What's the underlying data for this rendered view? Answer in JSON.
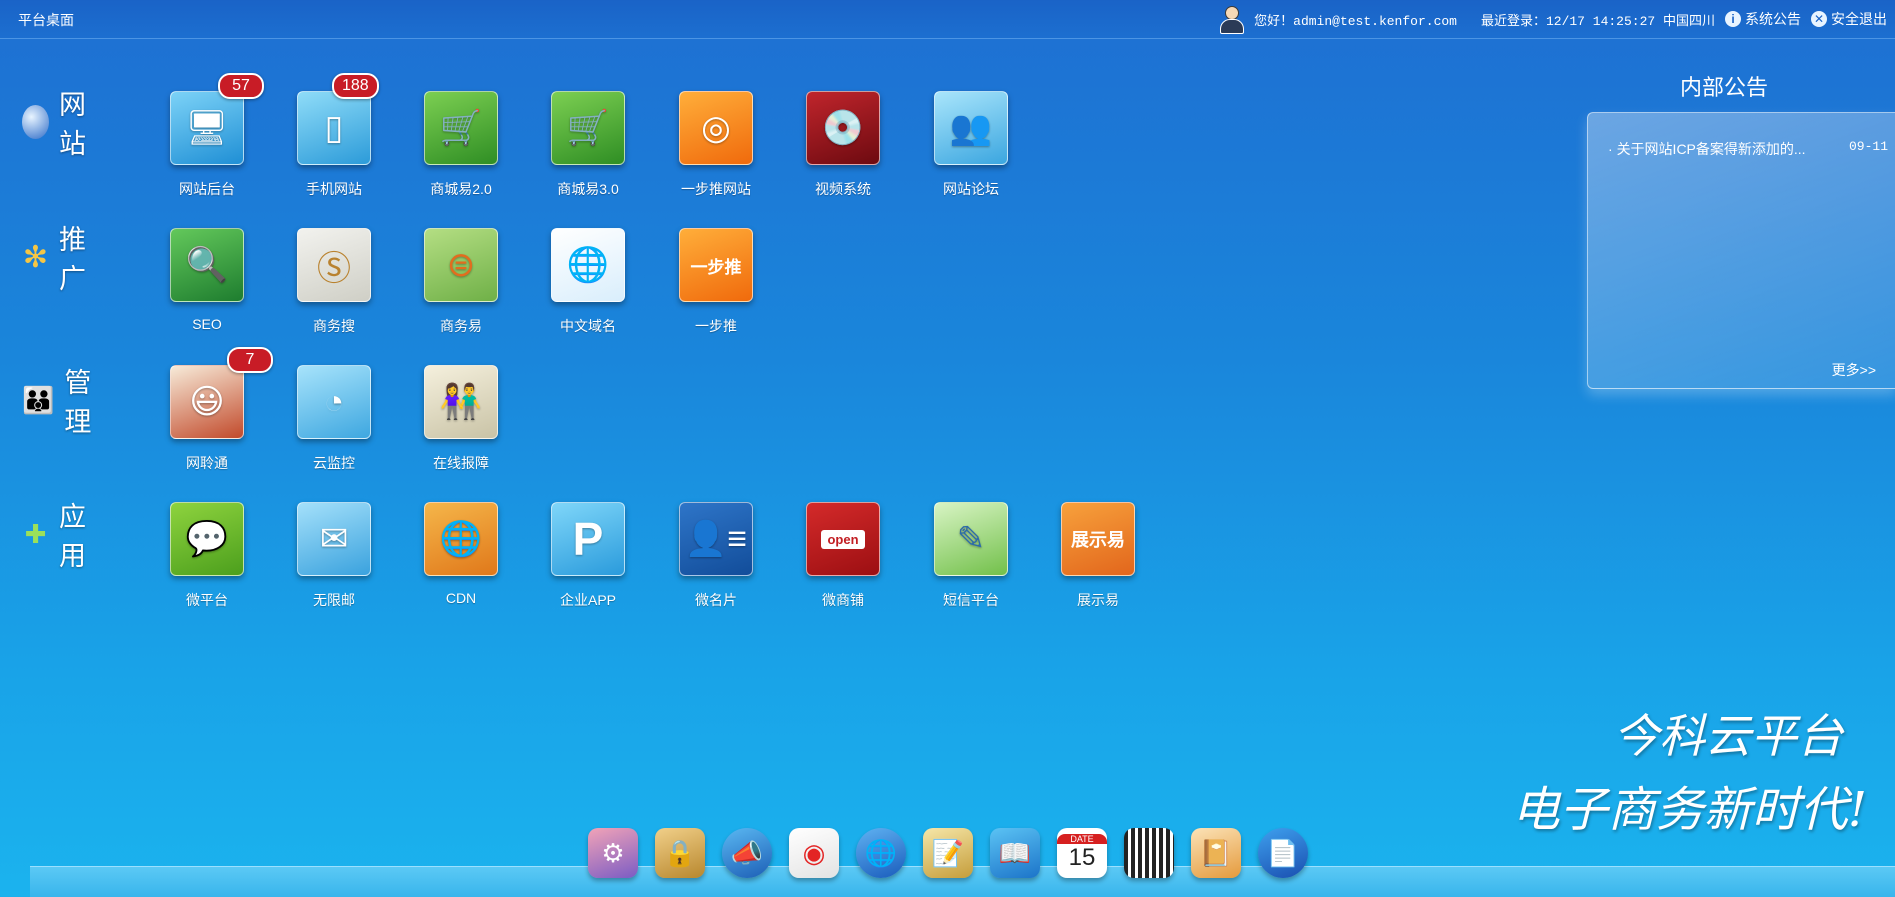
{
  "topbar": {
    "title": "平台桌面",
    "greeting": "您好！admin@test.kenfor.com",
    "last_login": "最近登录：12/17 14:25:27 中国四川",
    "notice_link": "系统公告",
    "logout_link": "安全退出"
  },
  "categories": [
    {
      "label": "网 站",
      "icon": "globe-icon"
    },
    {
      "label": "推 广",
      "icon": "star-icon"
    },
    {
      "label": "管 理",
      "icon": "people-icon"
    },
    {
      "label": "应 用",
      "icon": "apps-icon"
    }
  ],
  "apps": {
    "website": [
      {
        "label": "网站后台",
        "icon": "monitor-globe-icon",
        "badge": "57"
      },
      {
        "label": "手机网站",
        "icon": "tablet-icon",
        "badge": "188"
      },
      {
        "label": "商城易2.0",
        "icon": "cart-icon"
      },
      {
        "label": "商城易3.0",
        "icon": "cart-icon"
      },
      {
        "label": "一步推网站",
        "icon": "compass-icon"
      },
      {
        "label": "视频系统",
        "icon": "dvd-icon"
      },
      {
        "label": "网站论坛",
        "icon": "forum-people-icon"
      }
    ],
    "promotion": [
      {
        "label": "SEO",
        "icon": "magnifier-icon"
      },
      {
        "label": "商务搜",
        "icon": "s-logo-icon"
      },
      {
        "label": "商务易",
        "icon": "coin-logo-icon"
      },
      {
        "label": "中文域名",
        "icon": "domain-globe-icon"
      },
      {
        "label": "一步推",
        "icon": "yibutui-icon",
        "glyph_text": "一步推"
      }
    ],
    "manage": [
      {
        "label": "网聆通",
        "icon": "smiley-icon",
        "badge": "7"
      },
      {
        "label": "云监控",
        "icon": "pie-chart-icon"
      },
      {
        "label": "在线报障",
        "icon": "support-people-icon"
      }
    ],
    "apps": [
      {
        "label": "微平台",
        "icon": "phone-chat-icon"
      },
      {
        "label": "无限邮",
        "icon": "envelope-icon"
      },
      {
        "label": "CDN",
        "icon": "globe-orb-icon"
      },
      {
        "label": "企业APP",
        "icon": "p-logo-icon"
      },
      {
        "label": "微名片",
        "icon": "business-card-icon"
      },
      {
        "label": "微商铺",
        "icon": "shop-open-icon",
        "glyph_text": "open"
      },
      {
        "label": "短信平台",
        "icon": "sms-pen-icon"
      },
      {
        "label": "展示易",
        "icon": "zhanshiyi-icon",
        "glyph_text": "展示易"
      }
    ]
  },
  "notice": {
    "title": "内部公告",
    "items": [
      {
        "text": "关于网站ICP备案得新添加的...",
        "date": "09-11"
      }
    ],
    "more": "更多>>"
  },
  "slogan": {
    "line1": "今科云平台",
    "line2": "电子商务新时代!"
  },
  "dock": [
    {
      "icon": "user-settings-icon"
    },
    {
      "icon": "lock-icon"
    },
    {
      "icon": "megaphone-icon"
    },
    {
      "icon": "weibo-icon"
    },
    {
      "icon": "globe-icon"
    },
    {
      "icon": "notepad-search-icon"
    },
    {
      "icon": "book-icon"
    },
    {
      "icon": "calendar-icon",
      "label": "DATE",
      "value": "15"
    },
    {
      "icon": "qr-code-icon"
    },
    {
      "icon": "notebook-icon"
    },
    {
      "icon": "document-icon"
    }
  ],
  "colors": {
    "background": "#1a86db",
    "badge": "#c81c26"
  }
}
